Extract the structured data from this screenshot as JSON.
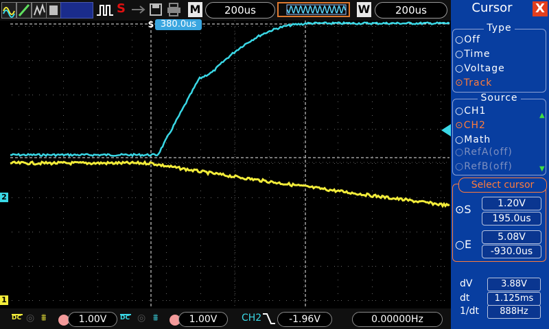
{
  "toolbar": {
    "mode_label": "M",
    "timebase": "200us",
    "window_label": "W",
    "window_timebase": "200us",
    "run_state_label": "S"
  },
  "screen": {
    "cursor_s_time": "380.0us",
    "cursor_s_marker": "S"
  },
  "panel": {
    "title": "Cursor",
    "close_label": "X",
    "type_group": {
      "title": "Type",
      "options": [
        "Off",
        "Time",
        "Voltage",
        "Track"
      ],
      "selected": "Track"
    },
    "source_group": {
      "title": "Source",
      "options": [
        "CH1",
        "CH2",
        "Math",
        "RefA(off)",
        "RefB(off)"
      ],
      "selected": "CH2"
    },
    "select_cursor": {
      "title": "Select cursor",
      "s_label": "S",
      "s_voltage": "1.20V",
      "s_time": "195.0us",
      "e_label": "E",
      "e_voltage": "5.08V",
      "e_time": "-930.0us"
    },
    "readout": {
      "dv_label": "dV",
      "dv_value": "3.88V",
      "dt_label": "dt",
      "dt_value": "1.125ms",
      "inv_dt_label": "1/dt",
      "inv_dt_value": "888Hz"
    }
  },
  "status": {
    "ch1_scale": "1.00V",
    "ch2_scale": "1.00V",
    "ch1_coupling": "DC",
    "ch2_coupling": "DC",
    "trigger_source": "CH2",
    "trigger_level": "-1.96V",
    "frequency": "0.00000Hz"
  },
  "markers": {
    "ch1": "1",
    "ch2": "2"
  },
  "colors": {
    "ch1": "#f2ec3a",
    "ch2": "#3ad8e6",
    "panel_bg": "#083ea0",
    "accent": "#ff7c3c"
  }
}
